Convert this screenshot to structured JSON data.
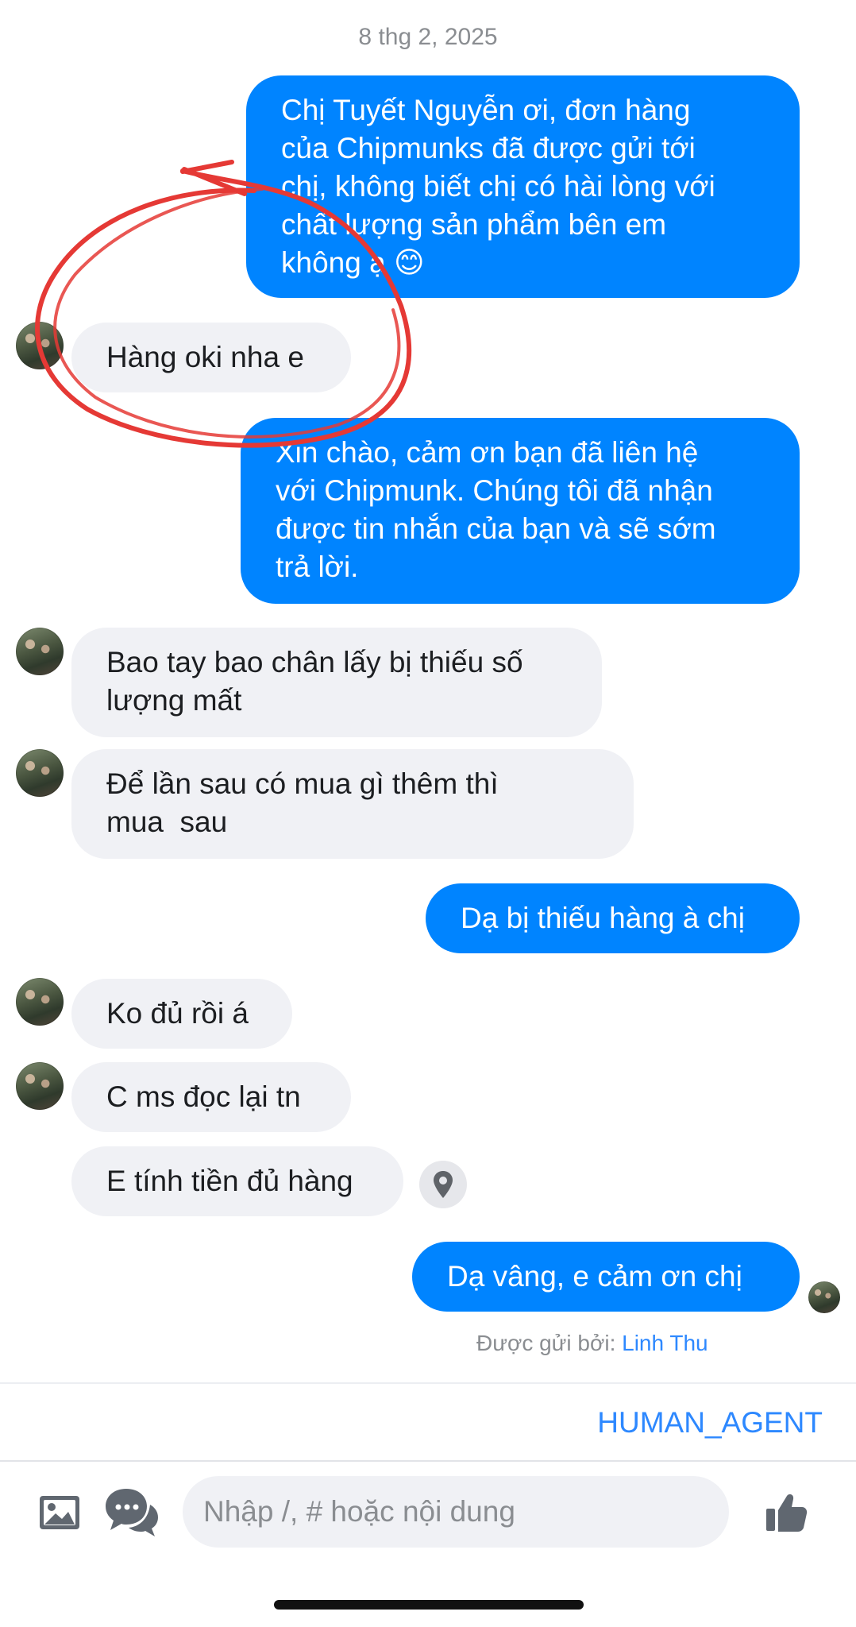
{
  "conversation": {
    "date": "8  thg 2, 2025",
    "messages": [
      {
        "dir": "out",
        "text": "Chị Tuyết Nguyễn ơi, đơn hàng\ncủa Chipmunks đã được gửi tới\nchị, không biết chị có hài lòng với\nchất lượng sản phẩm bên em\nkhông ạ 😊"
      },
      {
        "dir": "in",
        "text": "Hàng oki nha e"
      },
      {
        "dir": "out",
        "text": "Xin chào, cảm ơn bạn đã liên hệ\nvới Chipmunk. Chúng tôi đã nhận\nđược tin nhắn của bạn và sẽ sớm\ntrả lời."
      },
      {
        "dir": "in",
        "text": "Bao tay bao chân lấy bị thiếu số\nlượng mất"
      },
      {
        "dir": "in",
        "text": "Để lần sau có mua gì thêm thì\nmua  sau"
      },
      {
        "dir": "out",
        "text": "Dạ bị thiếu hàng à chị"
      },
      {
        "dir": "in",
        "text": "Ko đủ rồi á"
      },
      {
        "dir": "in",
        "text": "C ms đọc lại tn"
      },
      {
        "dir": "in",
        "text": "E tính tiền đủ hàng"
      },
      {
        "dir": "out",
        "text": "Dạ vâng, e cảm ơn chị"
      }
    ],
    "sent_by_label": "Được gửi bởi:",
    "sent_by_name": "Linh Thu"
  },
  "agent_bar": {
    "label": "HUMAN_AGENT"
  },
  "composer": {
    "placeholder": "Nhập /, # hoặc nội dung",
    "image_icon": "image-icon",
    "quick_reply_icon": "chat-bubbles-icon",
    "like_icon": "thumbs-up-icon"
  },
  "message_side_icon": "location-pin-icon",
  "colors": {
    "outgoing_bubble": "#0084ff",
    "incoming_bubble": "#f0f1f5",
    "accent_text": "#2d88ff",
    "annotation": "#e53935"
  }
}
